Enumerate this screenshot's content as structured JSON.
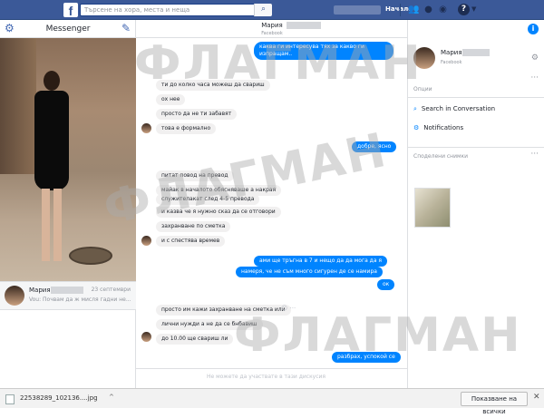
{
  "topbar": {
    "logo": "f",
    "search_placeholder": "Търсене на хора, места и неща",
    "home_label": "Начало",
    "icons": [
      "friends-icon",
      "messages-icon",
      "notifications-icon",
      "help-icon"
    ]
  },
  "left": {
    "title": "Messenger",
    "conversation": {
      "name": "Мария",
      "date": "23 септември",
      "preview": "Vou: Почвам да ж мисля гадни не..."
    }
  },
  "main": {
    "header_name": "Мария",
    "header_sub": "Facebook",
    "messages": [
      {
        "side": "out",
        "text": "каква ги интересува тях за какво ги изпращам.."
      },
      {
        "side": "in",
        "text": "ти до колко часа можеш да свариш"
      },
      {
        "side": "in",
        "text": "ох нее"
      },
      {
        "side": "in",
        "text": "просто да не ти забавят"
      },
      {
        "side": "in",
        "text": "това е формално"
      },
      {
        "side": "out",
        "text": "добре, ясно"
      },
      {
        "side": "in",
        "text": "питат повод на превод"
      },
      {
        "side": "in",
        "text": "майак в началото обясняваше а накрая"
      },
      {
        "side": "in",
        "text": "служителакат след 4-5 превода"
      },
      {
        "side": "in",
        "text": "и казва че я нужно сказ да се отговори"
      },
      {
        "side": "in",
        "text": "захранване по сметка"
      },
      {
        "side": "in",
        "text": "и с спестява времев"
      },
      {
        "side": "out",
        "text": "ами ще тръгна в 7 и нещо да да мога да я"
      },
      {
        "side": "out",
        "text": "намеря, че не съм много сигурен де се намира"
      },
      {
        "side": "out",
        "text": "ок"
      },
      {
        "side": "in",
        "text": "просто им кажи захранване на сметка или"
      },
      {
        "side": "in",
        "text": "лични нужди а не да се бнбавиш"
      },
      {
        "side": "in",
        "text": "до 10.00 ще свариш ли"
      },
      {
        "side": "out",
        "text": "разбрах, успокой се"
      }
    ],
    "composer_placeholder": "Не можете да участвате в тази дискусия"
  },
  "right": {
    "name": "Мария",
    "sub": "Facebook",
    "options_heading": "Опции",
    "options": [
      "Search in Conversation",
      "Notifications"
    ],
    "shared_heading": "Споделени снимки"
  },
  "downloads": {
    "file": "22538289_102136....jpg",
    "show_all": "Показване на всички"
  },
  "watermark": "ФЛАГМАН"
}
